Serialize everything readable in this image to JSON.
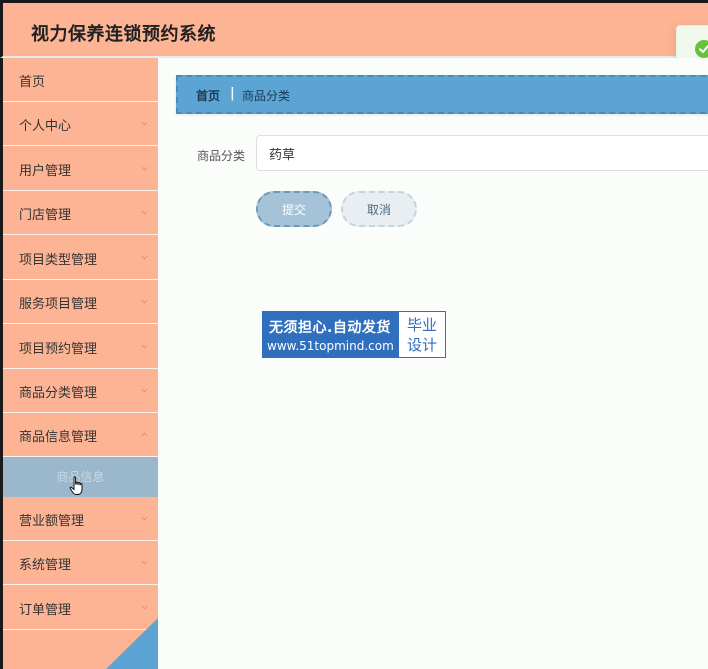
{
  "header": {
    "title": "视力保养连锁预约系统",
    "colors": {
      "bg": "#fdb495",
      "toast_icon": "#67c23a"
    },
    "toast_icon": "check-circle-icon"
  },
  "sidebar": {
    "items": [
      {
        "label": "首页",
        "has_children": false
      },
      {
        "label": "个人中心",
        "has_children": true
      },
      {
        "label": "用户管理",
        "has_children": true
      },
      {
        "label": "门店管理",
        "has_children": true
      },
      {
        "label": "项目类型管理",
        "has_children": true
      },
      {
        "label": "服务项目管理",
        "has_children": true
      },
      {
        "label": "项目预约管理",
        "has_children": true
      },
      {
        "label": "商品分类管理",
        "has_children": true
      },
      {
        "label": "商品信息管理",
        "has_children": true
      },
      {
        "label": "营业额管理",
        "has_children": true
      },
      {
        "label": "系统管理",
        "has_children": true
      },
      {
        "label": "订单管理",
        "has_children": true
      }
    ],
    "open_submenu": {
      "label": "商品信息"
    },
    "colors": {
      "bg": "#fdb495",
      "active_sub": "#9bb7cb"
    }
  },
  "breadcrumb": {
    "home": "首页",
    "separator": "|",
    "current": "商品分类"
  },
  "form": {
    "field_label": "商品分类",
    "field_value": "药草",
    "submit_label": "提交",
    "cancel_label": "取消"
  },
  "watermark": {
    "line1": "无须担心.自动发货",
    "line2": "www.51topmind.com",
    "right_top": "毕业",
    "right_bottom": "设计"
  },
  "colors": {
    "accent_blue": "#5ba4d4",
    "main_bg": "#fbfdfb"
  }
}
